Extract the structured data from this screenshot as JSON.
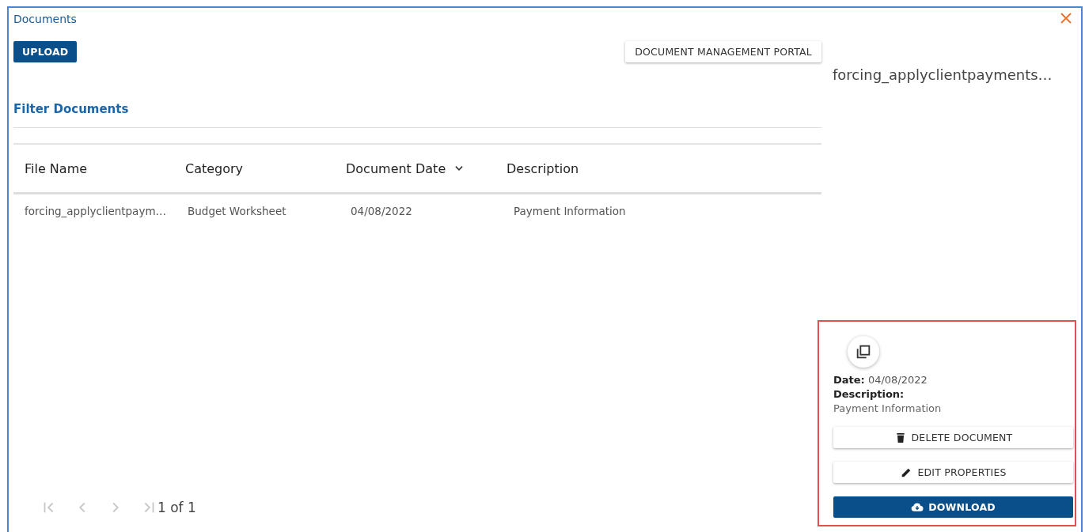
{
  "window": {
    "title": "Documents"
  },
  "toolbar": {
    "upload_button": "UPLOAD",
    "portal_button": "DOCUMENT MANAGEMENT PORTAL"
  },
  "filter": {
    "label": "Filter Documents"
  },
  "table": {
    "columns": [
      {
        "label": "File Name",
        "sorted": false
      },
      {
        "label": "Category",
        "sorted": false
      },
      {
        "label": "Document Date",
        "sorted": true
      },
      {
        "label": "Description",
        "sorted": false
      }
    ],
    "rows": [
      {
        "cells": [
          "forcing_applyclientpaym…",
          "Budget Worksheet",
          "04/08/2022",
          "Payment Information"
        ]
      }
    ]
  },
  "pager": {
    "buttons": [
      {
        "kind": "first",
        "disabled": true
      },
      {
        "kind": "prev",
        "disabled": true
      },
      {
        "kind": "next",
        "disabled": true
      },
      {
        "kind": "last",
        "disabled": true
      }
    ],
    "page_text": "1 of 1"
  },
  "details": {
    "title": "forcing_applyclientpayments…",
    "highlighted": true,
    "date_line": "**Date:** 04/08/2022",
    "description_label": "Description:",
    "description": "Payment Information",
    "actions": [
      {
        "kind": "delete",
        "label": "DELETE DOCUMENT"
      },
      {
        "kind": "edit",
        "label": "EDIT PROPERTIES"
      },
      {
        "kind": "download",
        "label": "DOWNLOAD"
      }
    ]
  }
}
